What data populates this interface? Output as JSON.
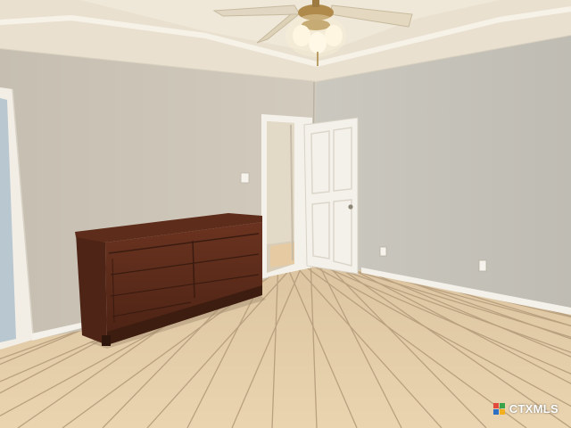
{
  "scene": {
    "description_free": true,
    "colors": {
      "wall_left": "#c9c2b4",
      "wall_right": "#c4c1b8",
      "ceiling": "#ece4d4",
      "floor_tile": "#e6cfaa",
      "grout": "#b89f7e",
      "trim": "#f4f1ea",
      "door": "#f3f0e8",
      "dresser": "#5a2a1a"
    },
    "icons": [
      "ceiling-fan-icon",
      "light-switch-icon",
      "power-outlet-icon"
    ]
  },
  "watermark": {
    "text": "CTXMLS"
  }
}
